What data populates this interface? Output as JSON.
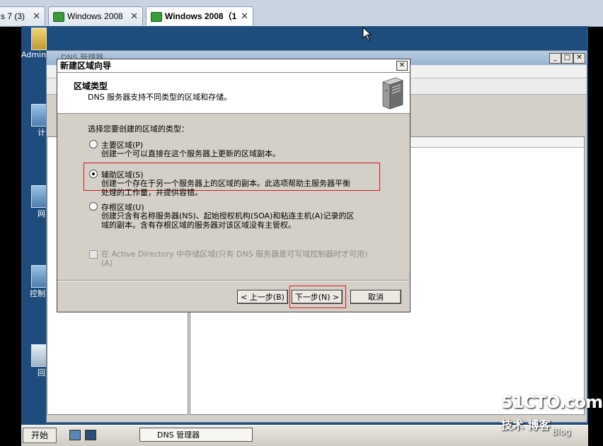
{
  "host_tabs": [
    {
      "label": "s 7 (3)",
      "active": false
    },
    {
      "label": "Windows 2008",
      "active": false
    },
    {
      "label": "Windows 2008（1",
      "active": true
    }
  ],
  "desktop": {
    "icons": [
      "Admin",
      "计",
      "网",
      "控制",
      "回"
    ]
  },
  "dns_window": {
    "title": "DNS 管理器",
    "col_fragment": "行"
  },
  "wizard": {
    "title": "新建区域向导",
    "header_title": "区域类型",
    "header_subtitle": "DNS 服务器支持不同类型的区域和存储。",
    "prompt": "选择您要创建的区域的类型：",
    "options": [
      {
        "label": "主要区域(P)",
        "desc": [
          "创建一个可以直接在这个服务器上更新的区域副本。"
        ],
        "selected": false
      },
      {
        "label": "辅助区域(S)",
        "desc": [
          "创建一个存在于另一个服务器上的区域的副本。此选项帮助主服务器平衡",
          "处理的工作量，并提供容错。"
        ],
        "selected": true
      },
      {
        "label": "存根区域(U)",
        "desc": [
          "创建只含有名称服务器(NS)、起始授权机构(SOA)和粘连主机(A)记录的区",
          "域的副本。含有存根区域的服务器对该区域没有主管权。"
        ],
        "selected": false
      }
    ],
    "ad_checkbox": {
      "label": [
        "在 Active Directory 中存储区域(只有 DNS 服务器是可写域控制器时才可用)",
        "(A)"
      ],
      "checked": false,
      "enabled": false
    },
    "buttons": {
      "back": "< 上一步(B)",
      "next": "下一步(N) >",
      "cancel": "取消"
    }
  },
  "taskbar": {
    "start": "开始",
    "task": "DNS 管理器"
  },
  "watermark": {
    "line1": "51CTO.com",
    "line2": "技术 博客",
    "line3": "Blog"
  },
  "colors": {
    "highlight": "#d21d1d",
    "desktop": "#1e4c7c"
  }
}
